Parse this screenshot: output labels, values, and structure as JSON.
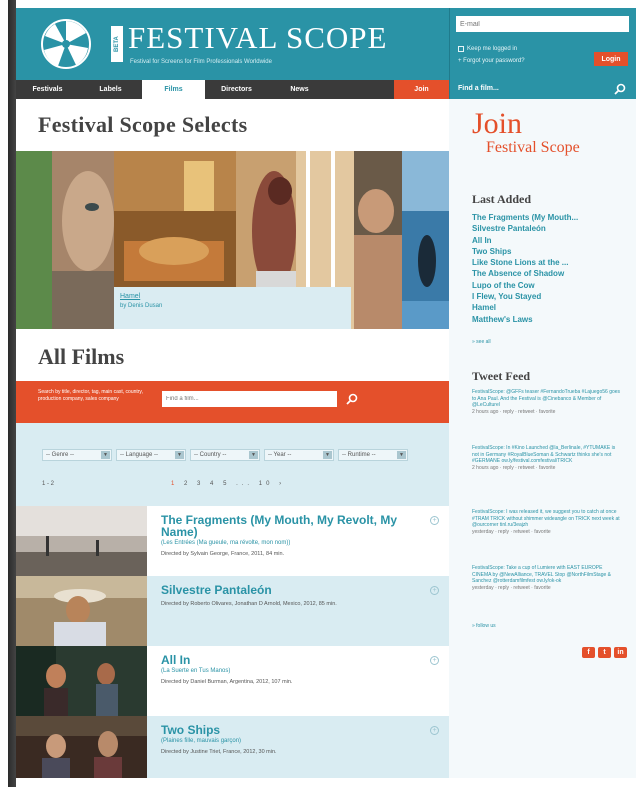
{
  "header": {
    "logo_text": "FESTIVAL SCOPE",
    "badge": "BETA",
    "tagline": "Festival for Screens for Film Professionals Worldwide"
  },
  "login": {
    "email_placeholder": "E-mail",
    "remember_label": "Keep me logged in",
    "forgot_label": "+ Forgot your password?",
    "login_button": "Login"
  },
  "nav": {
    "items": [
      "Festivals",
      "Labels",
      "Films",
      "Directors",
      "News"
    ],
    "active": "Films",
    "join": "Join"
  },
  "search": {
    "placeholder": "Find a film..."
  },
  "selects": {
    "title": "Festival Scope Selects",
    "feature_title": "Hamel",
    "feature_subtitle": "by Denis Dusan"
  },
  "all_films": {
    "title": "All Films",
    "search_hint": "Search by title, director, tag, main cast, country, production company, sales company",
    "search_placeholder": "Find a film...",
    "filters": [
      "-- Genre --",
      "-- Language --",
      "-- Country --",
      "-- Year --",
      "-- Runtime --"
    ],
    "page_count": "1 - 2",
    "pager": [
      "1",
      "2",
      "3",
      "4",
      "5",
      "...",
      "10",
      "›"
    ]
  },
  "films": [
    {
      "title": "The Fragments (My Mouth, My Revolt, My Name)",
      "original": "(Les Entrées (Ma gueule, ma révolte, mon nom))",
      "director": "Directed by Sylvain George, France, 2011, 84 min."
    },
    {
      "title": "Silvestre Pantaleón",
      "original": "",
      "director": "Directed by Roberto Olivares, Jonathan D Arnold, Mexico, 2012, 85 min."
    },
    {
      "title": "All In",
      "original": "(La Suerte en Tus Manos)",
      "director": "Directed by Daniel Burman, Argentina, 2012, 107 min."
    },
    {
      "title": "Two Ships",
      "original": "(Plaines fille, mauvais garçon)",
      "director": "Directed by Justine Triet, France, 2012, 30 min."
    }
  ],
  "sidebar": {
    "join_title": "Join",
    "join_sub": "Festival Scope",
    "last_added_heading": "Last Added",
    "last_added": [
      "The Fragments (My Mouth...",
      "Silvestre Pantaleón",
      "All In",
      "Two Ships",
      "Like Stone Lions at the ...",
      "The Absence of Shadow",
      "Lupo of the Cow",
      "I Flew, You Stayed",
      "Hamel",
      "Matthew's Laws"
    ],
    "more": "» see all",
    "tweet_heading": "Tweet Feed",
    "tweets": [
      {
        "text": "FestivalScope: @GFFs teaser #FernandoTrueba #Lajuego56 goes to Ana Paul. And the Festival is @Cinebanco & Member of @LeCulturel",
        "meta": "2 hours ago · reply · retweet · favorite"
      },
      {
        "text": "FestivalScope: In #Kino Launched @la_Berlinale, #YTUMAKE is not in Germany #RoyalBlueSoman & Schwartz thinks she's not #GERMANE ow.ly/festival.comfestival/TRICK",
        "meta": "2 hours ago · reply · retweet · favorite"
      },
      {
        "text": "FestivalScope: I was released it, we suggest you to catch at once #TRAM TRICK without shimmer wideangle on TRICK next week at @ourcorner tinl.ru/3eajzh",
        "meta": "yesterday · reply · retweet · favorite"
      },
      {
        "text": "FestivalScope: Take a cup of Lumiere with EAST EUROPE CINEMA by @NewAlliance, TRAVEL Stop @NorthFilmStage & Sanchez @rotterdamfilmfest ow.ly/ok-ok",
        "meta": "yesterday · reply · retweet · favorite"
      }
    ],
    "tweet_more": "» follow us",
    "social": [
      "f",
      "t",
      "in"
    ]
  },
  "colors": {
    "brand_teal": "#2a93a6",
    "accent_orange": "#e4502b",
    "panel_light_blue": "#d9ecf2"
  }
}
